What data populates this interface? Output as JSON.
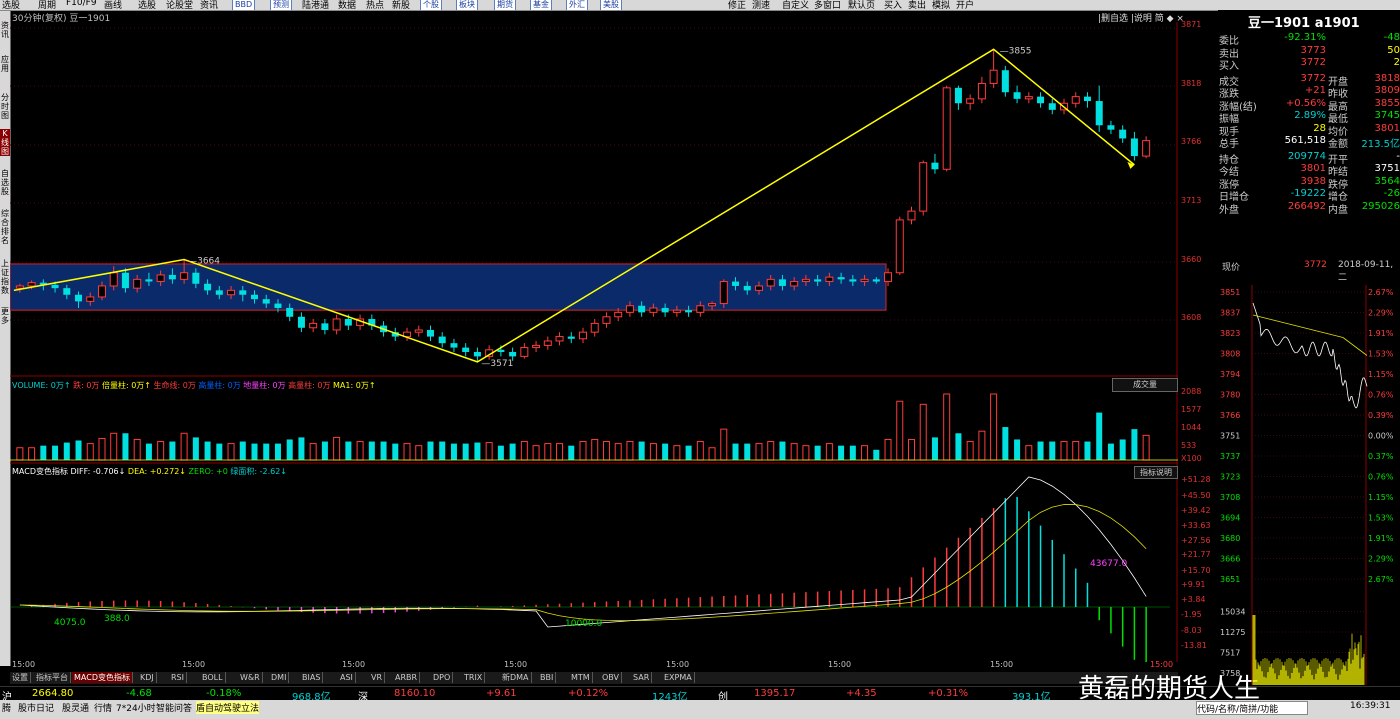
{
  "menu": {
    "items": [
      "选股",
      "周期",
      "F10/F9",
      "画线",
      "选股",
      "论股堂",
      "资讯"
    ],
    "buttons": [
      "BBD",
      "预测",
      "陆港通",
      "数据",
      "热点",
      "新股"
    ],
    "buttons2": [
      "个股",
      "板块",
      "期货",
      "基金",
      "外汇",
      "美股"
    ],
    "right": [
      "修正",
      "测速",
      "自定义",
      "多窗口",
      "默认页",
      "买入",
      "卖出",
      "模拟",
      "开户"
    ]
  },
  "left_tabs": [
    "资讯",
    "应用",
    "分时图",
    "K线图",
    "自选股",
    "综合排名",
    "上证指数",
    "更多"
  ],
  "chart": {
    "title": "30分钟(复权) 豆一1901",
    "tools": "|删自选 |说明 简 ◆ ×",
    "price_axis": [
      "3871",
      "3818",
      "3766",
      "3713",
      "3660",
      "3608"
    ],
    "annotations": {
      "high": "3855",
      "mid_high": "3664",
      "low": "3571"
    }
  },
  "volume": {
    "legend": [
      {
        "text": "VOLUME: 0万↑",
        "color": "#00d0d0"
      },
      {
        "text": "跌: 0万",
        "color": "#ff3c3c"
      },
      {
        "text": "倍量柱: 0万↑",
        "color": "#ffff00"
      },
      {
        "text": "生命线: 0万",
        "color": "#ff3c3c"
      },
      {
        "text": "高量柱: 0万",
        "color": "#0060ff"
      },
      {
        "text": "地量柱: 0万",
        "color": "#ff40ff"
      },
      {
        "text": "高量柱: 0万",
        "color": "#ff3c3c"
      },
      {
        "text": "MA1: 0万↑",
        "color": "#ffff00"
      }
    ],
    "button": "成交量",
    "axis": [
      "2088",
      "1577",
      "1044",
      "533",
      "X100"
    ]
  },
  "macd": {
    "legend": [
      {
        "text": "MACD变色指标 DIFF: -0.706↓",
        "color": "#ffffff"
      },
      {
        "text": "DEA: +0.272↓",
        "color": "#ffff00"
      },
      {
        "text": "ZERO: +0",
        "color": "#00d000"
      },
      {
        "text": "绿面积: -2.62↓",
        "color": "#00d0d0"
      }
    ],
    "button": "指标说明",
    "axis": [
      "+51.28",
      "+45.50",
      "+39.42",
      "+33.63",
      "+27.56",
      "+21.77",
      "+15.70",
      "+9.91",
      "+3.84",
      "-1.95",
      "-8.03",
      "-13.81"
    ],
    "labels": {
      "a": "4075.0",
      "b": "388.0",
      "c": "10000.0",
      "d": "43677.0"
    }
  },
  "x_labels": [
    "15:00",
    "15:00",
    "15:00",
    "15:00",
    "15:00",
    "15:00",
    "15:00",
    "15:00"
  ],
  "bottom_tabs": [
    "设置",
    "指标平台",
    "MACD变色指标",
    "KDJ",
    "RSI",
    "BOLL",
    "W&R",
    "DMI",
    "BIAS",
    "ASI",
    "VR",
    "ARBR",
    "DPO",
    "TRIX",
    "新DMA",
    "BBI",
    "MTM",
    "OBV",
    "SAR",
    "EXPMA"
  ],
  "ticker": {
    "sh_label": "沪",
    "sh_val": "2664.80",
    "sh_chg": "-4.68",
    "sh_pct": "-0.18%",
    "sh_amt": "968.8亿",
    "sz_label": "深",
    "sz_val": "8160.10",
    "sz_chg": "+9.61",
    "sz_pct": "+0.12%",
    "sz_amt": "1243亿",
    "cy_label": "创",
    "cy_val": "1395.17",
    "cy_chg": "+4.35",
    "cy_pct": "+0.31%",
    "cy_amt": "393.1亿",
    "watermark": "黄磊的期货人生"
  },
  "status": {
    "items": [
      "腾",
      "股市日记",
      "股灵通",
      "行情",
      "7*24小时",
      "智能问答"
    ],
    "highlight": "盾自动驾驶立法",
    "input": "代码/名称/简拼/功能",
    "time": "16:39:31"
  },
  "quote": {
    "title": "豆一1901 a1901",
    "rows": [
      {
        "l": "委比",
        "v": "-92.31%",
        "vc": "green",
        "v2": "-48",
        "v2c": "green"
      },
      {
        "l": "卖出",
        "v": "3773",
        "vc": "red",
        "v2": "50",
        "v2c": "yellow"
      },
      {
        "l": "买入",
        "v": "3772",
        "vc": "red",
        "v2": "2",
        "v2c": "yellow"
      },
      {
        "l": "成交",
        "v": "3772",
        "vc": "red",
        "l2": "开盘",
        "v2": "3818",
        "v2c": "red"
      },
      {
        "l": "涨跌",
        "v": "+21",
        "vc": "red",
        "l2": "昨收",
        "v2": "3809",
        "v2c": "red"
      },
      {
        "l": "涨幅(结)",
        "v": "+0.56%",
        "vc": "red",
        "l2": "最高",
        "v2": "3855",
        "v2c": "red"
      },
      {
        "l": "振幅",
        "v": "2.89%",
        "vc": "cyan",
        "l2": "最低",
        "v2": "3745",
        "v2c": "green"
      },
      {
        "l": "现手",
        "v": "28",
        "vc": "yellow",
        "l2": "均价",
        "v2": "3801",
        "v2c": "red"
      },
      {
        "l": "总手",
        "v": "561,518",
        "vc": "white",
        "l2": "金额",
        "v2": "213.5亿",
        "v2c": "cyan"
      },
      {
        "l": "持仓",
        "v": "209774",
        "vc": "cyan",
        "l2": "开平",
        "v2": "-",
        "v2c": "white"
      },
      {
        "l": "今结",
        "v": "3801",
        "vc": "red",
        "l2": "昨结",
        "v2": "3751",
        "v2c": "white"
      },
      {
        "l": "涨停",
        "v": "3938",
        "vc": "red",
        "l2": "跌停",
        "v2": "3564",
        "v2c": "green"
      },
      {
        "l": "日增仓",
        "v": "-19222",
        "vc": "cyan",
        "l2": "增仓",
        "v2": "-26",
        "v2c": "green"
      },
      {
        "l": "外盘",
        "v": "266492",
        "vc": "red",
        "l2": "内盘",
        "v2": "295026",
        "v2c": "green"
      }
    ]
  },
  "minute": {
    "label": "现价",
    "price": "3772",
    "date": "2018-09-11,二",
    "left_axis": [
      "3851",
      "3837",
      "3823",
      "3808",
      "3794",
      "3780",
      "3766",
      "3751",
      "3737",
      "3723",
      "3708",
      "3694",
      "3680",
      "3666",
      "3651",
      "15034",
      "11275",
      "7517",
      "3758"
    ],
    "right_axis": [
      "2.67%",
      "2.29%",
      "1.91%",
      "1.53%",
      "1.15%",
      "0.76%",
      "0.39%",
      "0.00%",
      "0.37%",
      "0.76%",
      "1.15%",
      "1.53%",
      "1.91%",
      "2.29%",
      "2.67%"
    ]
  },
  "candles": [
    [
      3638,
      3640,
      3634,
      3642
    ],
    [
      3640,
      3643,
      3637,
      3645
    ],
    [
      3643,
      3641,
      3636,
      3646
    ],
    [
      3641,
      3638,
      3634,
      3644
    ],
    [
      3638,
      3632,
      3628,
      3641
    ],
    [
      3632,
      3626,
      3620,
      3635
    ],
    [
      3626,
      3630,
      3622,
      3634
    ],
    [
      3630,
      3640,
      3627,
      3644
    ],
    [
      3640,
      3652,
      3636,
      3658
    ],
    [
      3652,
      3638,
      3634,
      3656
    ],
    [
      3638,
      3646,
      3634,
      3650
    ],
    [
      3646,
      3644,
      3640,
      3652
    ],
    [
      3644,
      3650,
      3640,
      3654
    ],
    [
      3650,
      3646,
      3642,
      3656
    ],
    [
      3646,
      3652,
      3642,
      3664
    ],
    [
      3652,
      3642,
      3638,
      3656
    ],
    [
      3642,
      3636,
      3632,
      3646
    ],
    [
      3636,
      3632,
      3628,
      3640
    ],
    [
      3632,
      3636,
      3628,
      3640
    ],
    [
      3636,
      3632,
      3626,
      3640
    ],
    [
      3632,
      3628,
      3624,
      3636
    ],
    [
      3628,
      3624,
      3620,
      3632
    ],
    [
      3624,
      3620,
      3616,
      3628
    ],
    [
      3620,
      3612,
      3608,
      3624
    ],
    [
      3612,
      3602,
      3598,
      3616
    ],
    [
      3602,
      3606,
      3598,
      3610
    ],
    [
      3606,
      3600,
      3596,
      3610
    ],
    [
      3600,
      3610,
      3596,
      3614
    ],
    [
      3610,
      3604,
      3600,
      3614
    ],
    [
      3604,
      3610,
      3600,
      3614
    ],
    [
      3610,
      3604,
      3600,
      3614
    ],
    [
      3604,
      3598,
      3594,
      3608
    ],
    [
      3598,
      3594,
      3590,
      3602
    ],
    [
      3594,
      3598,
      3590,
      3602
    ],
    [
      3598,
      3600,
      3594,
      3604
    ],
    [
      3600,
      3594,
      3590,
      3604
    ],
    [
      3594,
      3588,
      3584,
      3598
    ],
    [
      3588,
      3584,
      3580,
      3592
    ],
    [
      3584,
      3580,
      3576,
      3588
    ],
    [
      3580,
      3576,
      3571,
      3584
    ],
    [
      3576,
      3582,
      3573,
      3586
    ],
    [
      3582,
      3580,
      3576,
      3586
    ],
    [
      3580,
      3576,
      3572,
      3584
    ],
    [
      3576,
      3584,
      3574,
      3588
    ],
    [
      3584,
      3586,
      3580,
      3590
    ],
    [
      3586,
      3590,
      3582,
      3594
    ],
    [
      3590,
      3594,
      3586,
      3598
    ],
    [
      3594,
      3592,
      3588,
      3598
    ],
    [
      3592,
      3598,
      3588,
      3602
    ],
    [
      3598,
      3606,
      3594,
      3610
    ],
    [
      3606,
      3612,
      3602,
      3616
    ],
    [
      3612,
      3616,
      3608,
      3620
    ],
    [
      3616,
      3622,
      3612,
      3626
    ],
    [
      3622,
      3616,
      3612,
      3626
    ],
    [
      3616,
      3620,
      3612,
      3624
    ],
    [
      3620,
      3616,
      3612,
      3624
    ],
    [
      3616,
      3618,
      3612,
      3622
    ],
    [
      3618,
      3616,
      3612,
      3622
    ],
    [
      3616,
      3622,
      3612,
      3626
    ],
    [
      3622,
      3624,
      3618,
      3626
    ],
    [
      3624,
      3644,
      3620,
      3646
    ],
    [
      3644,
      3640,
      3636,
      3648
    ],
    [
      3640,
      3636,
      3632,
      3644
    ],
    [
      3636,
      3640,
      3632,
      3644
    ],
    [
      3640,
      3646,
      3636,
      3650
    ],
    [
      3646,
      3640,
      3636,
      3650
    ],
    [
      3640,
      3644,
      3636,
      3648
    ],
    [
      3644,
      3646,
      3640,
      3650
    ],
    [
      3646,
      3644,
      3640,
      3650
    ],
    [
      3644,
      3648,
      3640,
      3652
    ],
    [
      3648,
      3646,
      3642,
      3652
    ],
    [
      3646,
      3644,
      3640,
      3650
    ],
    [
      3644,
      3646,
      3640,
      3650
    ],
    [
      3646,
      3644,
      3642,
      3648
    ],
    [
      3644,
      3652,
      3640,
      3656
    ],
    [
      3652,
      3700,
      3650,
      3703
    ],
    [
      3700,
      3708,
      3696,
      3712
    ],
    [
      3708,
      3752,
      3704,
      3754
    ],
    [
      3752,
      3746,
      3742,
      3760
    ],
    [
      3746,
      3820,
      3744,
      3822
    ],
    [
      3820,
      3806,
      3800,
      3822
    ],
    [
      3806,
      3810,
      3800,
      3814
    ],
    [
      3810,
      3824,
      3806,
      3830
    ],
    [
      3824,
      3836,
      3820,
      3855
    ],
    [
      3836,
      3816,
      3812,
      3840
    ],
    [
      3816,
      3810,
      3806,
      3822
    ],
    [
      3810,
      3812,
      3806,
      3816
    ],
    [
      3812,
      3806,
      3802,
      3816
    ],
    [
      3806,
      3800,
      3796,
      3810
    ],
    [
      3800,
      3806,
      3796,
      3810
    ],
    [
      3806,
      3812,
      3802,
      3816
    ],
    [
      3812,
      3808,
      3802,
      3816
    ],
    [
      3808,
      3786,
      3780,
      3822
    ],
    [
      3786,
      3782,
      3778,
      3790
    ],
    [
      3782,
      3774,
      3770,
      3786
    ],
    [
      3774,
      3758,
      3754,
      3780
    ],
    [
      3758,
      3772,
      3756,
      3776
    ]
  ]
}
